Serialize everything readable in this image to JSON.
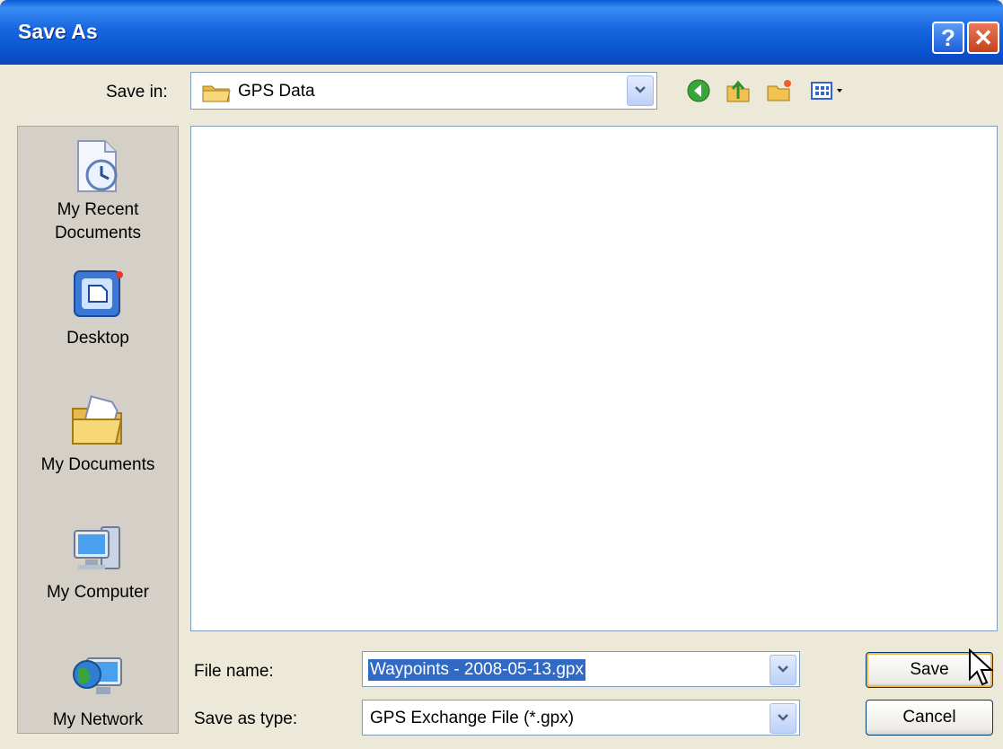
{
  "window": {
    "title": "Save As"
  },
  "titlebar": {
    "help_label": "?",
    "close_label": "✕"
  },
  "save_in": {
    "label": "Save in:",
    "value": "GPS Data"
  },
  "toolbar": {
    "icons": [
      "back-icon",
      "up-folder-icon",
      "new-folder-icon",
      "view-menu-icon"
    ]
  },
  "places": [
    {
      "id": "recent",
      "label_line1": "My Recent",
      "label_line2": "Documents"
    },
    {
      "id": "desktop",
      "label_line1": "Desktop"
    },
    {
      "id": "documents",
      "label_line1": "My Documents"
    },
    {
      "id": "computer",
      "label_line1": "My Computer"
    },
    {
      "id": "network",
      "label_line1": "My Network"
    }
  ],
  "file_name": {
    "label": "File name:",
    "value": "Waypoints - 2008-05-13.gpx"
  },
  "save_as_type": {
    "label": "Save as type:",
    "value": "GPS Exchange File (*.gpx)"
  },
  "buttons": {
    "save": "Save",
    "cancel": "Cancel"
  },
  "colors": {
    "title_bar": "#0b53cf",
    "dialog_bg": "#ece9d8",
    "selection": "#316ac5"
  }
}
